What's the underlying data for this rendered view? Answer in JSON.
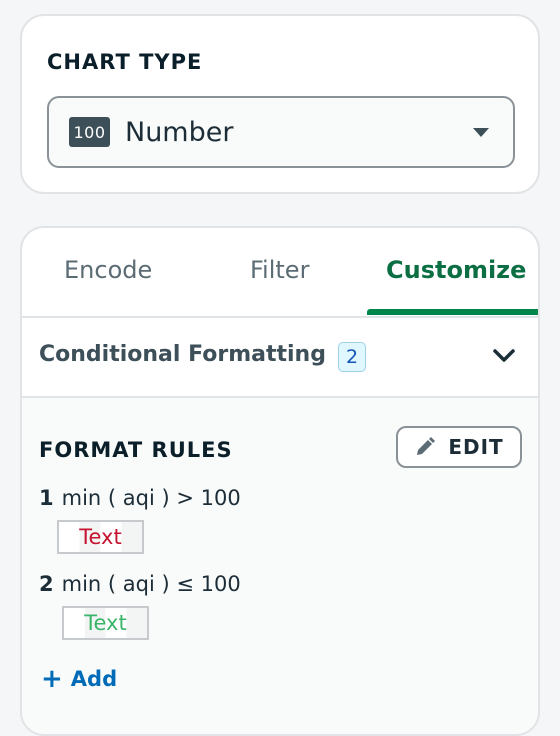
{
  "chart_type": {
    "heading": "CHART TYPE",
    "badge": "100",
    "selected": "Number"
  },
  "tabs": [
    {
      "label": "Encode"
    },
    {
      "label": "Filter"
    },
    {
      "label": "Customize",
      "active": true
    }
  ],
  "conditional_formatting": {
    "title": "Conditional Formatting",
    "count": "2",
    "format_rules_heading": "FORMAT RULES",
    "edit_label": "EDIT",
    "rules": [
      {
        "index": "1",
        "condition": "min ( aqi ) > 100",
        "preview_text": "Text",
        "color": "#c4122f"
      },
      {
        "index": "2",
        "condition": "min ( aqi ) ≤ 100",
        "preview_text": "Text",
        "color": "#3bb56a"
      }
    ],
    "add_symbol": "+",
    "add_label": "Add"
  },
  "colors": {
    "accent": "#00854a",
    "link": "#016bb8"
  }
}
